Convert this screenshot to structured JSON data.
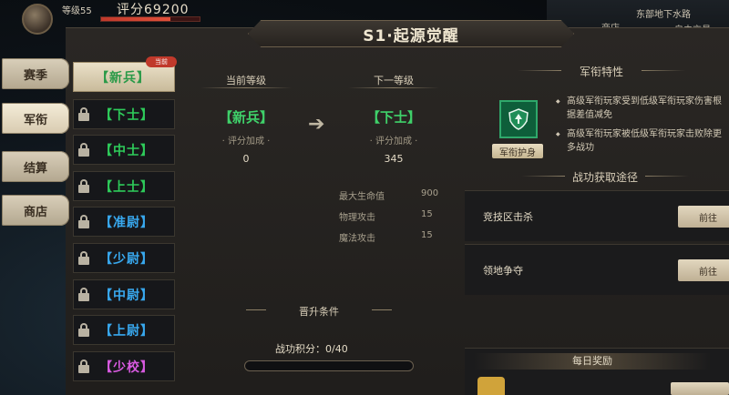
{
  "hud": {
    "level": "等级55",
    "score": "评分69200",
    "location": "东部地下水路",
    "btn1": "商店",
    "btn2": "自由交易"
  },
  "window": {
    "title": "S1·起源觉醒"
  },
  "side_tabs": [
    "赛季",
    "军衔",
    "结算",
    "商店"
  ],
  "ranks": [
    {
      "label": "【新兵】",
      "color": "#2ecb5a",
      "locked": false
    },
    {
      "label": "【下士】",
      "color": "#2ecb5a",
      "locked": true
    },
    {
      "label": "【中士】",
      "color": "#2ecb5a",
      "locked": true
    },
    {
      "label": "【上士】",
      "color": "#2ecb5a",
      "locked": true
    },
    {
      "label": "【准尉】",
      "color": "#38a8ee",
      "locked": true
    },
    {
      "label": "【少尉】",
      "color": "#38a8ee",
      "locked": true
    },
    {
      "label": "【中尉】",
      "color": "#38a8ee",
      "locked": true
    },
    {
      "label": "【上尉】",
      "color": "#38a8ee",
      "locked": true
    },
    {
      "label": "【少校】",
      "color": "#d85ae0",
      "locked": true
    }
  ],
  "current_badge": "当前",
  "current": {
    "head": "当前等级",
    "rank": "【新兵】",
    "sub": "· 评分加成 ·",
    "value": "0"
  },
  "next": {
    "head": "下一等级",
    "rank": "【下士】",
    "sub": "· 评分加成 ·",
    "value": "345"
  },
  "stats": [
    {
      "label": "最大生命值",
      "value": "900"
    },
    {
      "label": "物理攻击",
      "value": "15"
    },
    {
      "label": "魔法攻击",
      "value": "15"
    }
  ],
  "condition": {
    "head": "晋升条件",
    "merit": "战功积分：0/40",
    "progress_pct": 0
  },
  "traits": {
    "head": "军衔特性",
    "emblem_label": "军衔护身",
    "lines": [
      "高级军衔玩家受到低级军衔玩家伤害根据差值减免",
      "高级军衔玩家被低级军衔玩家击败除更多战功"
    ]
  },
  "ways": {
    "head": "战功获取途径",
    "items": [
      {
        "name": "竞技区击杀",
        "button": "前往"
      },
      {
        "name": "领地争夺",
        "button": "前往"
      }
    ]
  },
  "daily": {
    "head": "每日奖励"
  }
}
